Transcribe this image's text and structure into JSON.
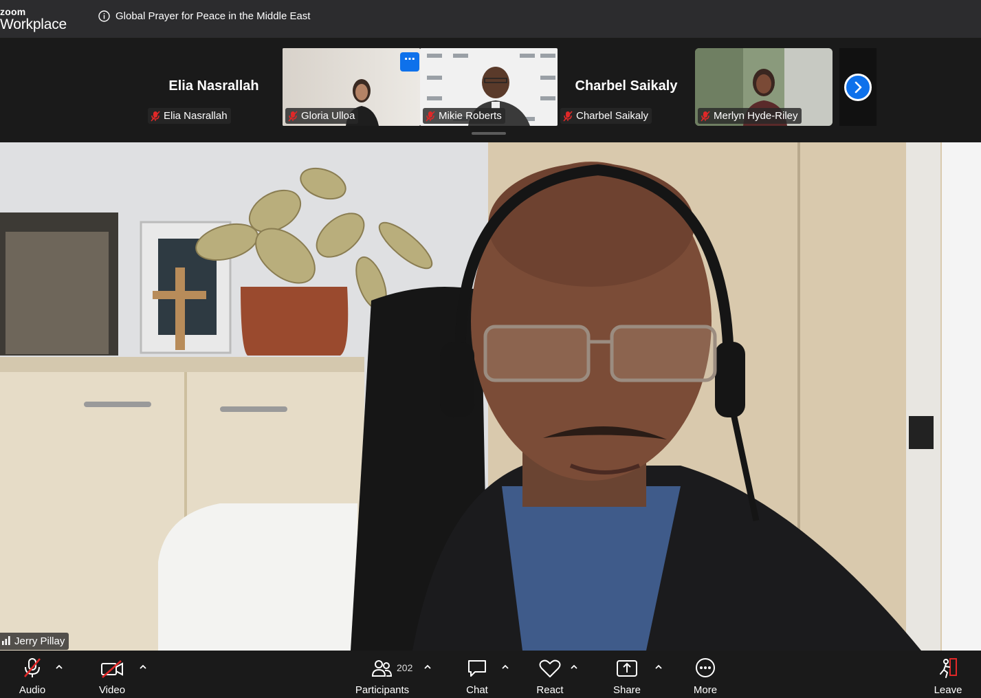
{
  "app": {
    "brand_small": "zoom",
    "brand_large": "Workplace"
  },
  "meeting": {
    "title": "Global Prayer for Peace in the Middle East"
  },
  "gallery": {
    "tiles": [
      {
        "name": "Elia Nasrallah",
        "label": "Elia Nasrallah",
        "video": false
      },
      {
        "name": "Gloria Ulloa",
        "label": "Gloria Ulloa",
        "video": true
      },
      {
        "name": "Mikie Roberts",
        "label": "Mikie Roberts",
        "video": true
      },
      {
        "name": "Charbel Saikaly",
        "label": "Charbel Saikaly",
        "video": false
      },
      {
        "name": "Merlyn Hyde-Riley",
        "label": "Merlyn Hyde-Riley",
        "video": true
      }
    ],
    "more_label": "⋯"
  },
  "speaker": {
    "name": "Jerry Pillay"
  },
  "toolbar": {
    "audio": "Audio",
    "video": "Video",
    "participants": "Participants",
    "participant_count": "202",
    "chat": "Chat",
    "react": "React",
    "share": "Share",
    "more": "More",
    "leave": "Leave"
  },
  "colors": {
    "accent": "#0e71eb",
    "muted_red": "#e02828",
    "leave_red": "#e02828"
  },
  "icons": {
    "info": "info-icon",
    "muted_mic": "muted-mic-icon",
    "next": "chevron-right-icon",
    "signal": "signal-bars-icon"
  }
}
